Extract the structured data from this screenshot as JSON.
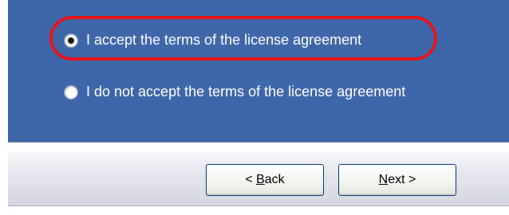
{
  "license": {
    "options": [
      {
        "label": "I accept the terms of the license agreement",
        "selected": true
      },
      {
        "label": "I do not accept the terms of the license agreement",
        "selected": false
      }
    ]
  },
  "buttons": {
    "back": {
      "prefix": "< ",
      "mnemonic": "B",
      "rest": "ack"
    },
    "next": {
      "mnemonic": "N",
      "rest": "ext >"
    }
  },
  "colors": {
    "panel_background": "#3e67a9",
    "highlight_ring": "#e8141c",
    "button_border": "#003c74"
  }
}
